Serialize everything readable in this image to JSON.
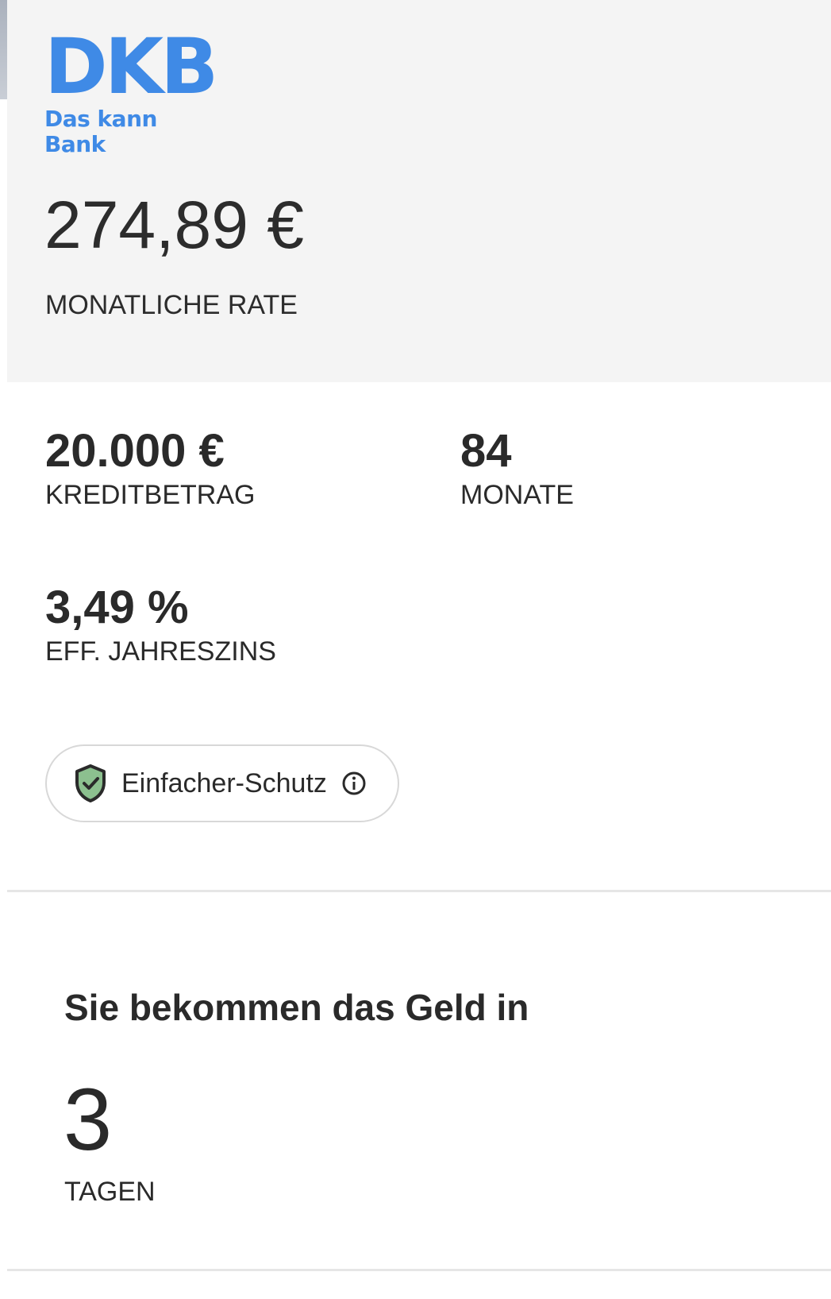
{
  "brand": {
    "name": "DKB",
    "claim": "Das kann Bank",
    "color": "#3f8ae6"
  },
  "rate": {
    "amount": "274,89 €",
    "label": "MONATLICHE RATE"
  },
  "stats": {
    "credit": {
      "value": "20.000 €",
      "label": "KREDITBETRAG"
    },
    "term": {
      "value": "84",
      "label": "MONATE"
    },
    "interest": {
      "value": "3,49 %",
      "label": "EFF. JAHRESZINS"
    }
  },
  "protection": {
    "label": "Einfacher-Schutz",
    "icon": "shield-check-icon",
    "info_icon": "info-icon",
    "shield_color": "#8cc08f"
  },
  "delivery": {
    "title": "Sie bekommen das Geld in",
    "days": "3",
    "unit": "TAGEN"
  }
}
